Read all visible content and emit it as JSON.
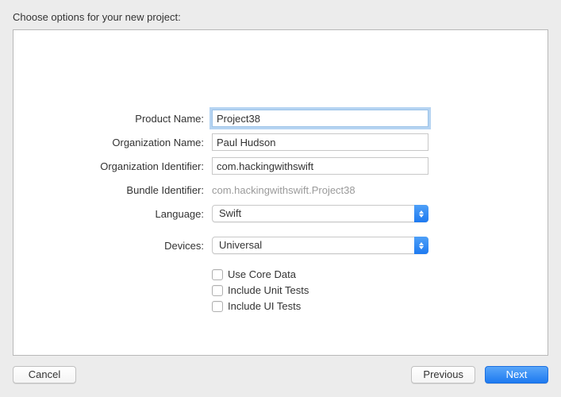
{
  "header": {
    "title": "Choose options for your new project:"
  },
  "form": {
    "product_name": {
      "label": "Product Name:",
      "value": "Project38"
    },
    "org_name": {
      "label": "Organization Name:",
      "value": "Paul Hudson"
    },
    "org_identifier": {
      "label": "Organization Identifier:",
      "value": "com.hackingwithswift"
    },
    "bundle_identifier": {
      "label": "Bundle Identifier:",
      "value": "com.hackingwithswift.Project38"
    },
    "language": {
      "label": "Language:",
      "value": "Swift"
    },
    "devices": {
      "label": "Devices:",
      "value": "Universal"
    },
    "checkboxes": {
      "core_data": {
        "label": "Use Core Data",
        "checked": false
      },
      "unit_tests": {
        "label": "Include Unit Tests",
        "checked": false
      },
      "ui_tests": {
        "label": "Include UI Tests",
        "checked": false
      }
    }
  },
  "buttons": {
    "cancel": "Cancel",
    "previous": "Previous",
    "next": "Next"
  }
}
